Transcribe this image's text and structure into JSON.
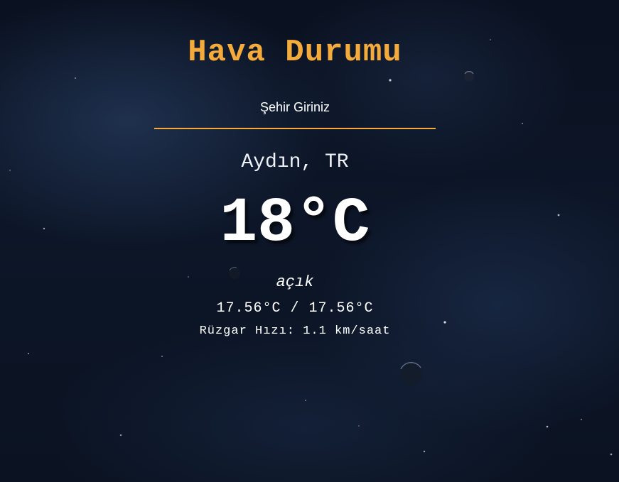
{
  "app": {
    "title": "Hava Durumu"
  },
  "search": {
    "placeholder": "Şehir Giriniz",
    "value": ""
  },
  "weather": {
    "location": "Aydın, TR",
    "temperature": "18°C",
    "condition": "açık",
    "min_max": "17.56°C / 17.56°C",
    "wind": "Rüzgar Hızı: 1.1 km/saat"
  },
  "colors": {
    "accent": "#f5aa3c",
    "text": "#ffffff",
    "background": "#0d1628"
  },
  "icons": {
    "background": "space-starfield-image"
  }
}
